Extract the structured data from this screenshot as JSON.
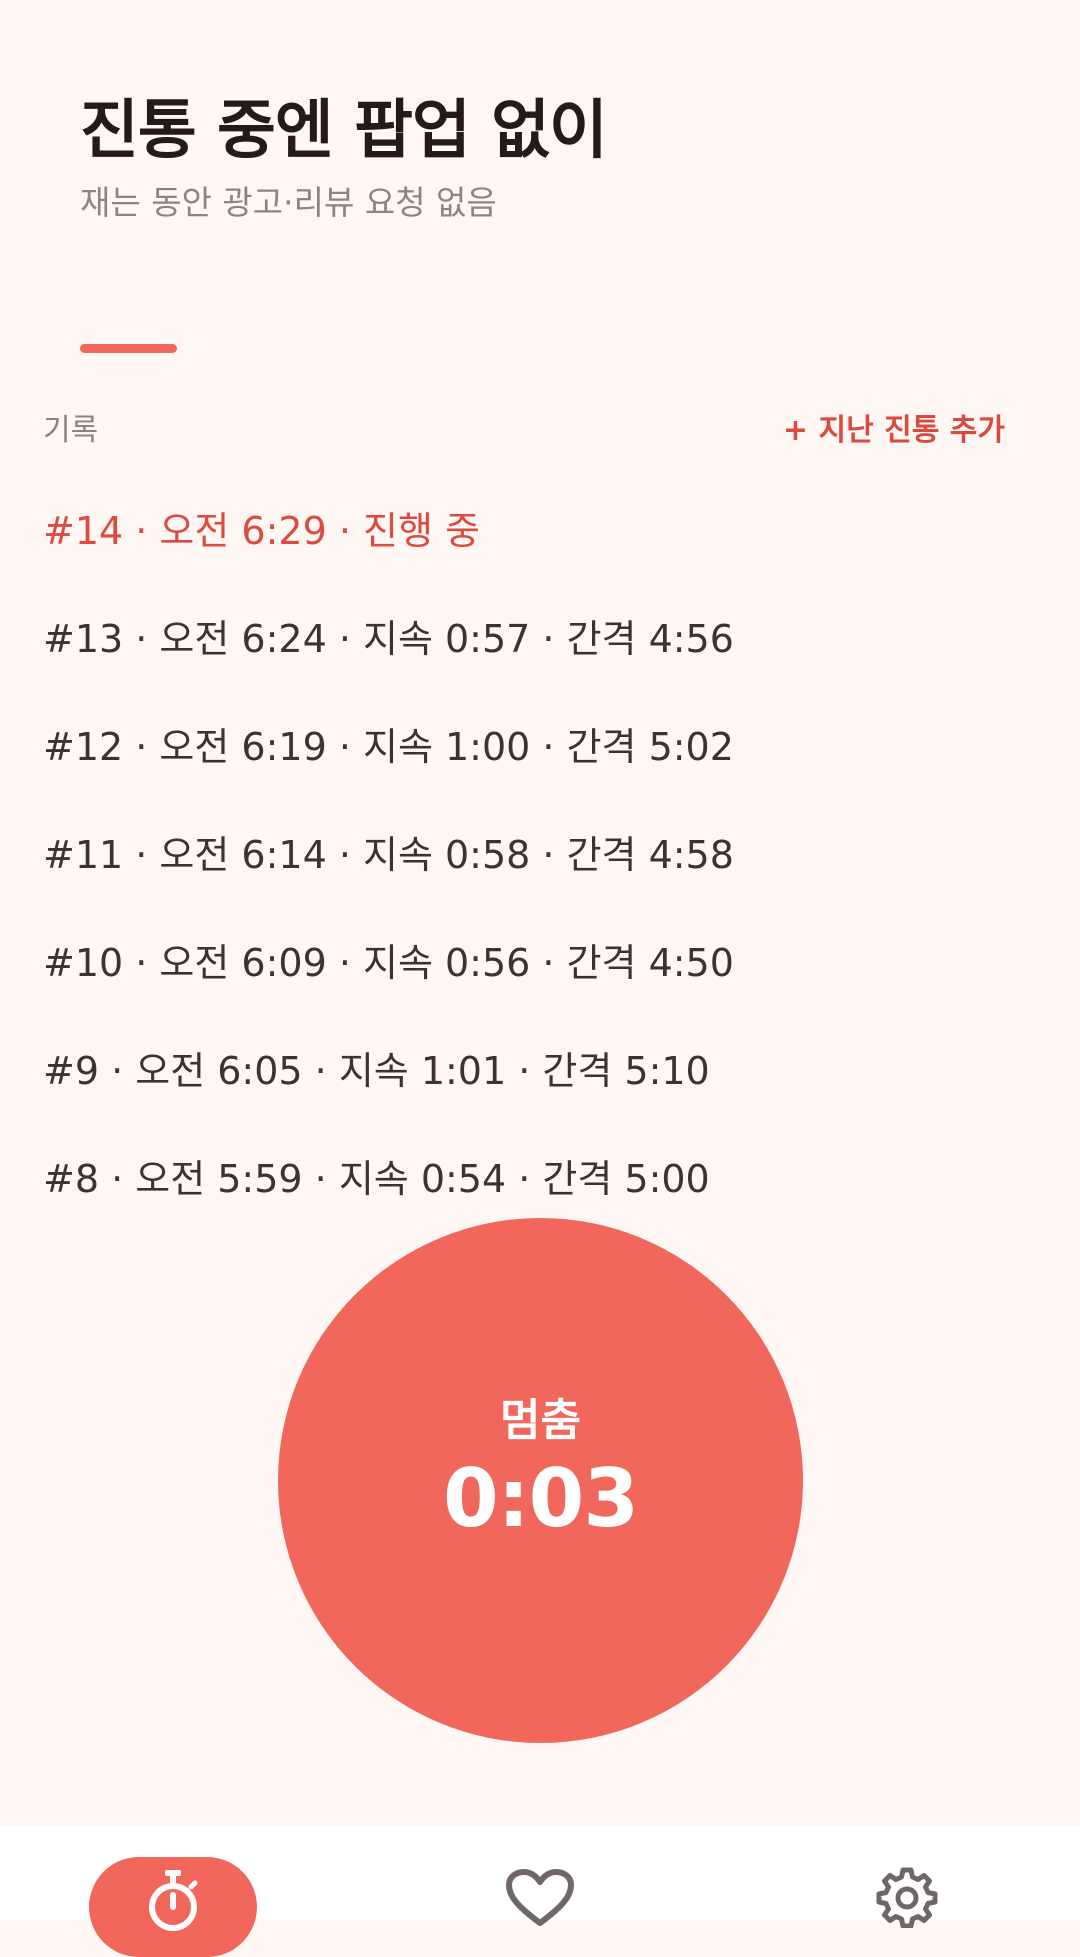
{
  "header": {
    "title": "진통 중엔 팝업 없이",
    "subtitle": "재는 동안 광고·리뷰 요청 없음"
  },
  "records_section": {
    "label": "기록",
    "add_past_label": "+ 지난 진통 추가"
  },
  "records": [
    "#14 · 오전 6:29 · 진행 중",
    "#13 · 오전 6:24 · 지속 0:57 · 간격 4:56",
    "#12 · 오전 6:19 · 지속 1:00 · 간격 5:02",
    "#11 · 오전 6:14 · 지속 0:58 · 간격 4:58",
    "#10 · 오전 6:09 · 지속 0:56 · 간격 4:50",
    "#9 · 오전 6:05 · 지속 1:01 · 간격 5:10",
    "#8 · 오전 5:59 · 지속 0:54 · 간격 5:00"
  ],
  "timer_button": {
    "label": "멈춤",
    "elapsed": "0:03"
  },
  "bottom_nav": {
    "items": [
      {
        "icon": "stopwatch-icon",
        "selected": true
      },
      {
        "icon": "heart-icon",
        "selected": false
      },
      {
        "icon": "gear-icon",
        "selected": false
      }
    ]
  },
  "colors": {
    "background": "#FFF7F4",
    "accent": "#F2675C",
    "active_text": "#DE4A3F",
    "nav_background": "#FFFFFF"
  }
}
